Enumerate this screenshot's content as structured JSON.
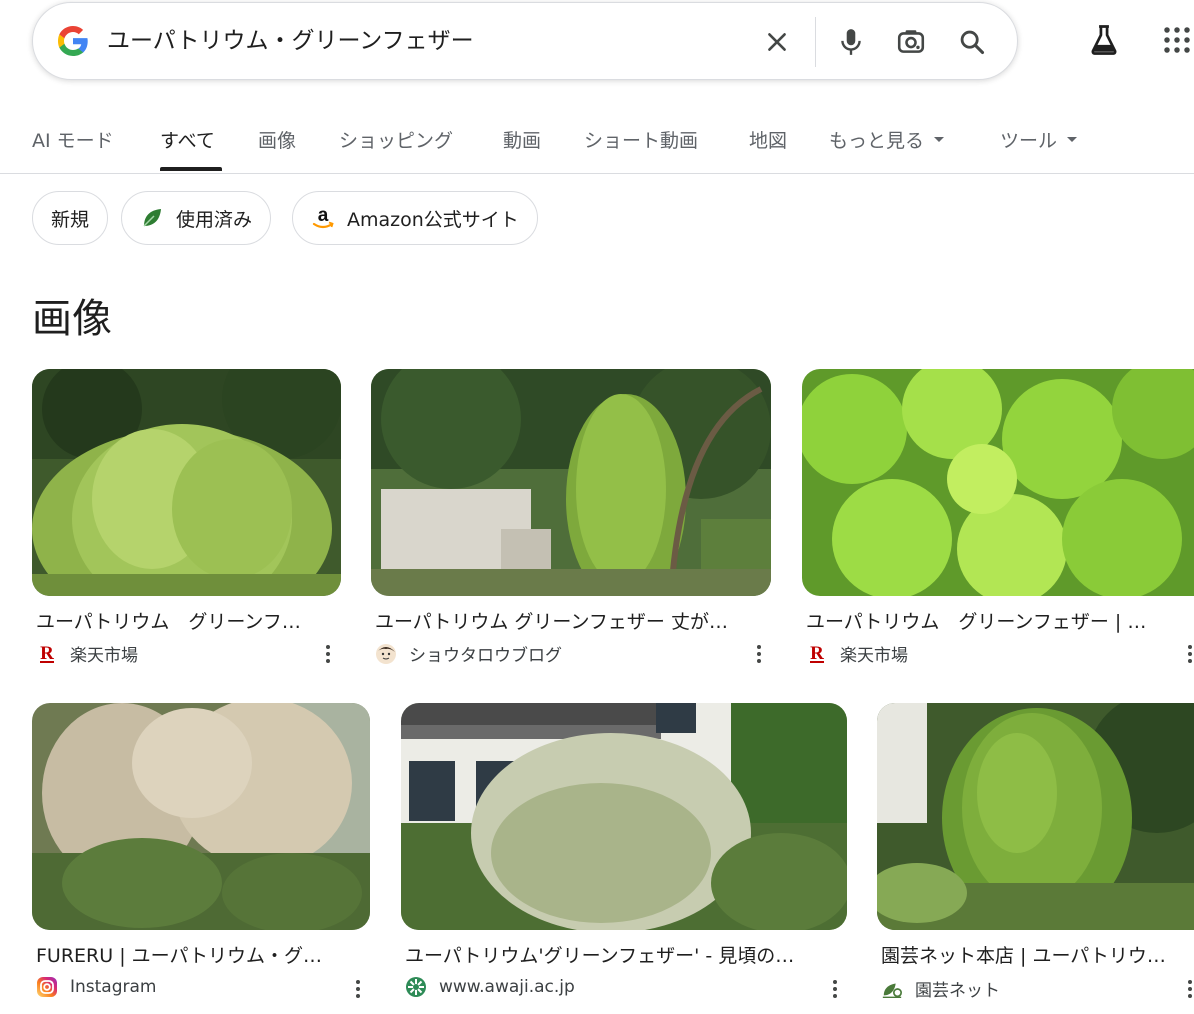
{
  "search": {
    "query": "ユーパトリウム・グリーンフェザー"
  },
  "tabs": [
    {
      "label": "AI モード"
    },
    {
      "label": "すべて"
    },
    {
      "label": "画像"
    },
    {
      "label": "ショッピング"
    },
    {
      "label": "動画"
    },
    {
      "label": "ショート動画"
    },
    {
      "label": "地図"
    },
    {
      "label": "もっと見る"
    },
    {
      "label": "ツール"
    }
  ],
  "chips": [
    {
      "label": "新規"
    },
    {
      "label": "使用済み"
    },
    {
      "label": "Amazon公式サイト"
    }
  ],
  "section": {
    "title": "画像"
  },
  "images": [
    {
      "caption": "ユーパトリウム　グリーンフ…",
      "source": "楽天市場"
    },
    {
      "caption": "ユーパトリウム グリーンフェザー 丈が…",
      "source": "ショウタロウブログ"
    },
    {
      "caption": "ユーパトリウム　グリーンフェザー | …",
      "source": "楽天市場"
    },
    {
      "caption": "FURERU | ユーパトリウム・グ…",
      "source": "Instagram"
    },
    {
      "caption": "ユーパトリウム'グリーンフェザー' - 見頃の…",
      "source": "www.awaji.ac.jp"
    },
    {
      "caption": "園芸ネット本店 | ユーパトリウ…",
      "source": "園芸ネット"
    }
  ],
  "colors": {
    "rakuten": "#bf0000",
    "accent_green": "#2e7d32"
  }
}
